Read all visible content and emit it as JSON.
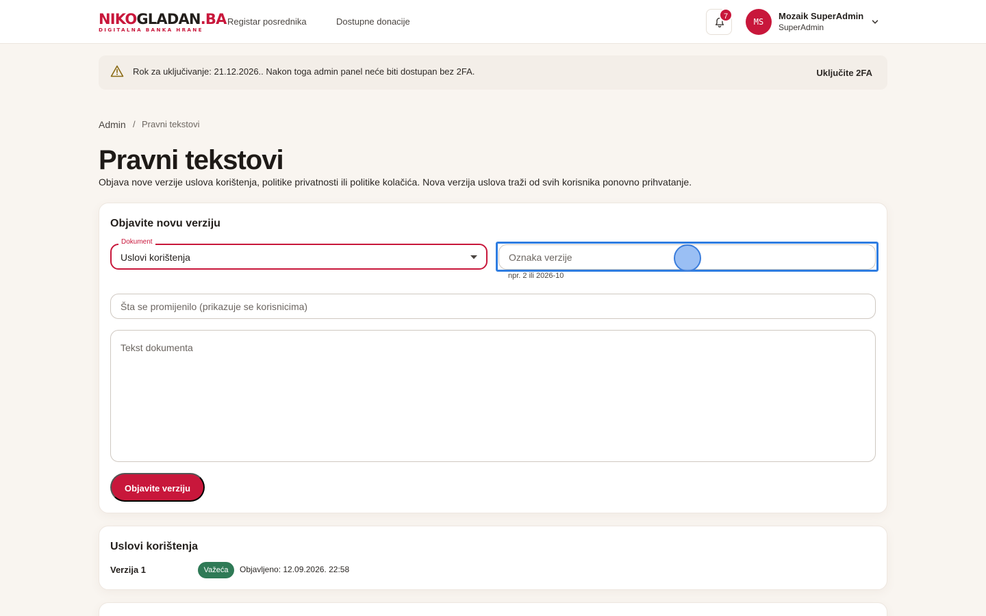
{
  "header": {
    "logo": {
      "part1": "NIKO",
      "part2": "GLADAN",
      "part3": ".BA",
      "tagline": "DIGITALNA BANKA HRANE"
    },
    "nav": [
      {
        "label": "Registar posrednika"
      },
      {
        "label": "Dostupne donacije"
      }
    ],
    "notifications_count": "7",
    "user": {
      "initials": "MS",
      "name": "Mozaik SuperAdmin",
      "role": "SuperAdmin"
    }
  },
  "banner": {
    "text": "Rok za uključivanje: 21.12.2026.. Nakon toga admin panel neće biti dostupan bez 2FA.",
    "action": "Uključite 2FA"
  },
  "breadcrumb": {
    "root": "Admin",
    "separator": "/",
    "current": "Pravni tekstovi"
  },
  "page": {
    "title": "Pravni tekstovi",
    "description": "Objava nove verzije uslova korištenja, politike privatnosti ili politike kolačića. Nova verzija uslova traži od svih korisnika ponovno prihvatanje."
  },
  "form": {
    "title": "Objavite novu verziju",
    "document_label": "Dokument",
    "document_value": "Uslovi korištenja",
    "version_placeholder": "Oznaka verzije",
    "version_helper": "npr. 2 ili 2026-10",
    "changes_placeholder": "Šta se promijenilo (prikazuje se korisnicima)",
    "text_placeholder": "Tekst dokumenta",
    "submit_label": "Objavite verziju"
  },
  "versions": {
    "title": "Uslovi korištenja",
    "items": [
      {
        "label": "Verzija 1",
        "status": "Važeća",
        "published": "Objavljeno: 12.09.2026. 22:58"
      }
    ]
  },
  "colors": {
    "brand": "#c8173b",
    "focus": "#2f7de1",
    "status_current": "#2f7a56"
  },
  "icons": [
    "warning-icon",
    "bell-icon",
    "chevron-down-icon",
    "dropdown-caret-icon"
  ]
}
